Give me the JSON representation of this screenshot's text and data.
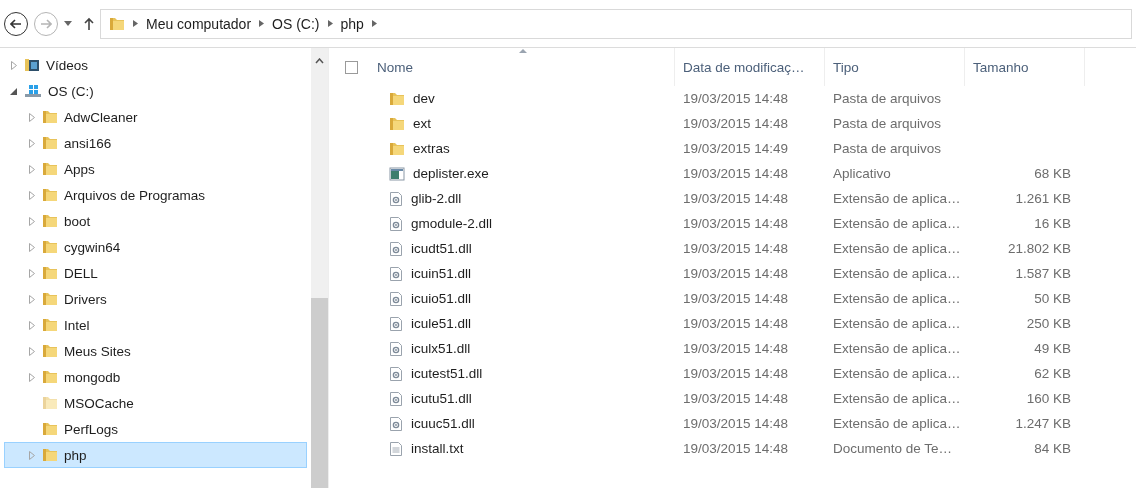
{
  "navigation": {
    "back_enabled": true,
    "forward_enabled": false,
    "breadcrumb": [
      "Meu computador",
      "OS (C:)",
      "php"
    ]
  },
  "tree": [
    {
      "label": "Vídeos",
      "kind": "videos",
      "expandable": true,
      "expanded": false,
      "selected": false
    },
    {
      "label": "OS (C:)",
      "kind": "drive",
      "expandable": true,
      "expanded": true,
      "selected": false,
      "children": [
        {
          "label": "AdwCleaner",
          "kind": "folder",
          "expandable": true,
          "expanded": false,
          "selected": false
        },
        {
          "label": "ansi166",
          "kind": "folder",
          "expandable": true,
          "expanded": false,
          "selected": false
        },
        {
          "label": "Apps",
          "kind": "folder",
          "expandable": true,
          "expanded": false,
          "selected": false
        },
        {
          "label": "Arquivos de Programas",
          "kind": "folder",
          "expandable": true,
          "expanded": false,
          "selected": false
        },
        {
          "label": "boot",
          "kind": "folder",
          "expandable": true,
          "expanded": false,
          "selected": false
        },
        {
          "label": "cygwin64",
          "kind": "folder",
          "expandable": true,
          "expanded": false,
          "selected": false
        },
        {
          "label": "DELL",
          "kind": "folder",
          "expandable": true,
          "expanded": false,
          "selected": false
        },
        {
          "label": "Drivers",
          "kind": "folder",
          "expandable": true,
          "expanded": false,
          "selected": false
        },
        {
          "label": "Intel",
          "kind": "folder",
          "expandable": true,
          "expanded": false,
          "selected": false
        },
        {
          "label": "Meus Sites",
          "kind": "folder",
          "expandable": true,
          "expanded": false,
          "selected": false
        },
        {
          "label": "mongodb",
          "kind": "folder",
          "expandable": true,
          "expanded": false,
          "selected": false
        },
        {
          "label": "MSOCache",
          "kind": "hidden-folder",
          "expandable": false,
          "selected": false
        },
        {
          "label": "PerfLogs",
          "kind": "folder",
          "expandable": false,
          "selected": false
        },
        {
          "label": "php",
          "kind": "folder",
          "expandable": true,
          "expanded": false,
          "selected": true
        }
      ]
    }
  ],
  "file_list": {
    "select_all_checked": false,
    "columns": [
      {
        "label": "Nome",
        "sorted": true
      },
      {
        "label": "Data de modificaç…",
        "sorted": false
      },
      {
        "label": "Tipo",
        "sorted": false
      },
      {
        "label": "Tamanho",
        "sorted": false
      }
    ],
    "rows": [
      {
        "kind": "folder",
        "name": "dev",
        "modified": "19/03/2015 14:48",
        "type": "Pasta de arquivos"
      },
      {
        "kind": "folder",
        "name": "ext",
        "modified": "19/03/2015 14:48",
        "type": "Pasta de arquivos"
      },
      {
        "kind": "folder",
        "name": "extras",
        "modified": "19/03/2015 14:49",
        "type": "Pasta de arquivos"
      },
      {
        "kind": "exe",
        "name": "deplister.exe",
        "modified": "19/03/2015 14:48",
        "type": "Aplicativo",
        "size": "68 KB"
      },
      {
        "kind": "dll",
        "name": "glib-2.dll",
        "modified": "19/03/2015 14:48",
        "type": "Extensão de aplica…",
        "size": "1.261 KB"
      },
      {
        "kind": "dll",
        "name": "gmodule-2.dll",
        "modified": "19/03/2015 14:48",
        "type": "Extensão de aplica…",
        "size": "16 KB"
      },
      {
        "kind": "dll",
        "name": "icudt51.dll",
        "modified": "19/03/2015 14:48",
        "type": "Extensão de aplica…",
        "size": "21.802 KB"
      },
      {
        "kind": "dll",
        "name": "icuin51.dll",
        "modified": "19/03/2015 14:48",
        "type": "Extensão de aplica…",
        "size": "1.587 KB"
      },
      {
        "kind": "dll",
        "name": "icuio51.dll",
        "modified": "19/03/2015 14:48",
        "type": "Extensão de aplica…",
        "size": "50 KB"
      },
      {
        "kind": "dll",
        "name": "icule51.dll",
        "modified": "19/03/2015 14:48",
        "type": "Extensão de aplica…",
        "size": "250 KB"
      },
      {
        "kind": "dll",
        "name": "iculx51.dll",
        "modified": "19/03/2015 14:48",
        "type": "Extensão de aplica…",
        "size": "49 KB"
      },
      {
        "kind": "dll",
        "name": "icutest51.dll",
        "modified": "19/03/2015 14:48",
        "type": "Extensão de aplica…",
        "size": "62 KB"
      },
      {
        "kind": "dll",
        "name": "icutu51.dll",
        "modified": "19/03/2015 14:48",
        "type": "Extensão de aplica…",
        "size": "160 KB"
      },
      {
        "kind": "dll",
        "name": "icuuc51.dll",
        "modified": "19/03/2015 14:48",
        "type": "Extensão de aplica…",
        "size": "1.247 KB"
      },
      {
        "kind": "txt",
        "name": "install.txt",
        "modified": "19/03/2015 14:48",
        "type": "Documento de Te…",
        "size": "84 KB"
      }
    ]
  }
}
